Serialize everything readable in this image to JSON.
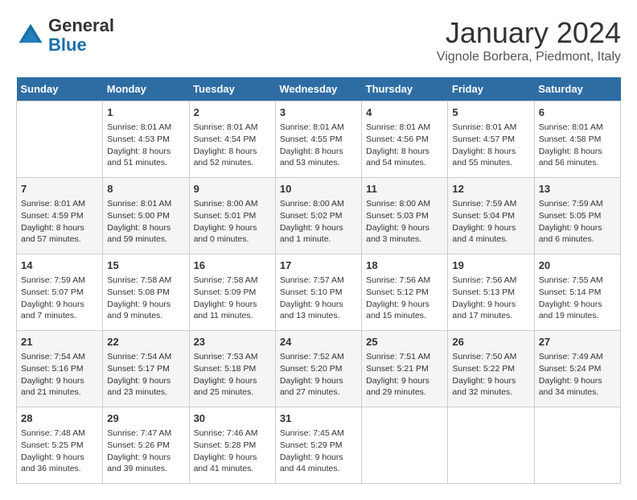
{
  "header": {
    "logo_general": "General",
    "logo_blue": "Blue",
    "month_title": "January 2024",
    "location": "Vignole Borbera, Piedmont, Italy"
  },
  "days_of_week": [
    "Sunday",
    "Monday",
    "Tuesday",
    "Wednesday",
    "Thursday",
    "Friday",
    "Saturday"
  ],
  "weeks": [
    [
      {
        "day": "",
        "info": ""
      },
      {
        "day": "1",
        "info": "Sunrise: 8:01 AM\nSunset: 4:53 PM\nDaylight: 8 hours\nand 51 minutes."
      },
      {
        "day": "2",
        "info": "Sunrise: 8:01 AM\nSunset: 4:54 PM\nDaylight: 8 hours\nand 52 minutes."
      },
      {
        "day": "3",
        "info": "Sunrise: 8:01 AM\nSunset: 4:55 PM\nDaylight: 8 hours\nand 53 minutes."
      },
      {
        "day": "4",
        "info": "Sunrise: 8:01 AM\nSunset: 4:56 PM\nDaylight: 8 hours\nand 54 minutes."
      },
      {
        "day": "5",
        "info": "Sunrise: 8:01 AM\nSunset: 4:57 PM\nDaylight: 8 hours\nand 55 minutes."
      },
      {
        "day": "6",
        "info": "Sunrise: 8:01 AM\nSunset: 4:58 PM\nDaylight: 8 hours\nand 56 minutes."
      }
    ],
    [
      {
        "day": "7",
        "info": "Sunrise: 8:01 AM\nSunset: 4:59 PM\nDaylight: 8 hours\nand 57 minutes."
      },
      {
        "day": "8",
        "info": "Sunrise: 8:01 AM\nSunset: 5:00 PM\nDaylight: 8 hours\nand 59 minutes."
      },
      {
        "day": "9",
        "info": "Sunrise: 8:00 AM\nSunset: 5:01 PM\nDaylight: 9 hours\nand 0 minutes."
      },
      {
        "day": "10",
        "info": "Sunrise: 8:00 AM\nSunset: 5:02 PM\nDaylight: 9 hours\nand 1 minute."
      },
      {
        "day": "11",
        "info": "Sunrise: 8:00 AM\nSunset: 5:03 PM\nDaylight: 9 hours\nand 3 minutes."
      },
      {
        "day": "12",
        "info": "Sunrise: 7:59 AM\nSunset: 5:04 PM\nDaylight: 9 hours\nand 4 minutes."
      },
      {
        "day": "13",
        "info": "Sunrise: 7:59 AM\nSunset: 5:05 PM\nDaylight: 9 hours\nand 6 minutes."
      }
    ],
    [
      {
        "day": "14",
        "info": "Sunrise: 7:59 AM\nSunset: 5:07 PM\nDaylight: 9 hours\nand 7 minutes."
      },
      {
        "day": "15",
        "info": "Sunrise: 7:58 AM\nSunset: 5:08 PM\nDaylight: 9 hours\nand 9 minutes."
      },
      {
        "day": "16",
        "info": "Sunrise: 7:58 AM\nSunset: 5:09 PM\nDaylight: 9 hours\nand 11 minutes."
      },
      {
        "day": "17",
        "info": "Sunrise: 7:57 AM\nSunset: 5:10 PM\nDaylight: 9 hours\nand 13 minutes."
      },
      {
        "day": "18",
        "info": "Sunrise: 7:56 AM\nSunset: 5:12 PM\nDaylight: 9 hours\nand 15 minutes."
      },
      {
        "day": "19",
        "info": "Sunrise: 7:56 AM\nSunset: 5:13 PM\nDaylight: 9 hours\nand 17 minutes."
      },
      {
        "day": "20",
        "info": "Sunrise: 7:55 AM\nSunset: 5:14 PM\nDaylight: 9 hours\nand 19 minutes."
      }
    ],
    [
      {
        "day": "21",
        "info": "Sunrise: 7:54 AM\nSunset: 5:16 PM\nDaylight: 9 hours\nand 21 minutes."
      },
      {
        "day": "22",
        "info": "Sunrise: 7:54 AM\nSunset: 5:17 PM\nDaylight: 9 hours\nand 23 minutes."
      },
      {
        "day": "23",
        "info": "Sunrise: 7:53 AM\nSunset: 5:18 PM\nDaylight: 9 hours\nand 25 minutes."
      },
      {
        "day": "24",
        "info": "Sunrise: 7:52 AM\nSunset: 5:20 PM\nDaylight: 9 hours\nand 27 minutes."
      },
      {
        "day": "25",
        "info": "Sunrise: 7:51 AM\nSunset: 5:21 PM\nDaylight: 9 hours\nand 29 minutes."
      },
      {
        "day": "26",
        "info": "Sunrise: 7:50 AM\nSunset: 5:22 PM\nDaylight: 9 hours\nand 32 minutes."
      },
      {
        "day": "27",
        "info": "Sunrise: 7:49 AM\nSunset: 5:24 PM\nDaylight: 9 hours\nand 34 minutes."
      }
    ],
    [
      {
        "day": "28",
        "info": "Sunrise: 7:48 AM\nSunset: 5:25 PM\nDaylight: 9 hours\nand 36 minutes."
      },
      {
        "day": "29",
        "info": "Sunrise: 7:47 AM\nSunset: 5:26 PM\nDaylight: 9 hours\nand 39 minutes."
      },
      {
        "day": "30",
        "info": "Sunrise: 7:46 AM\nSunset: 5:28 PM\nDaylight: 9 hours\nand 41 minutes."
      },
      {
        "day": "31",
        "info": "Sunrise: 7:45 AM\nSunset: 5:29 PM\nDaylight: 9 hours\nand 44 minutes."
      },
      {
        "day": "",
        "info": ""
      },
      {
        "day": "",
        "info": ""
      },
      {
        "day": "",
        "info": ""
      }
    ]
  ]
}
